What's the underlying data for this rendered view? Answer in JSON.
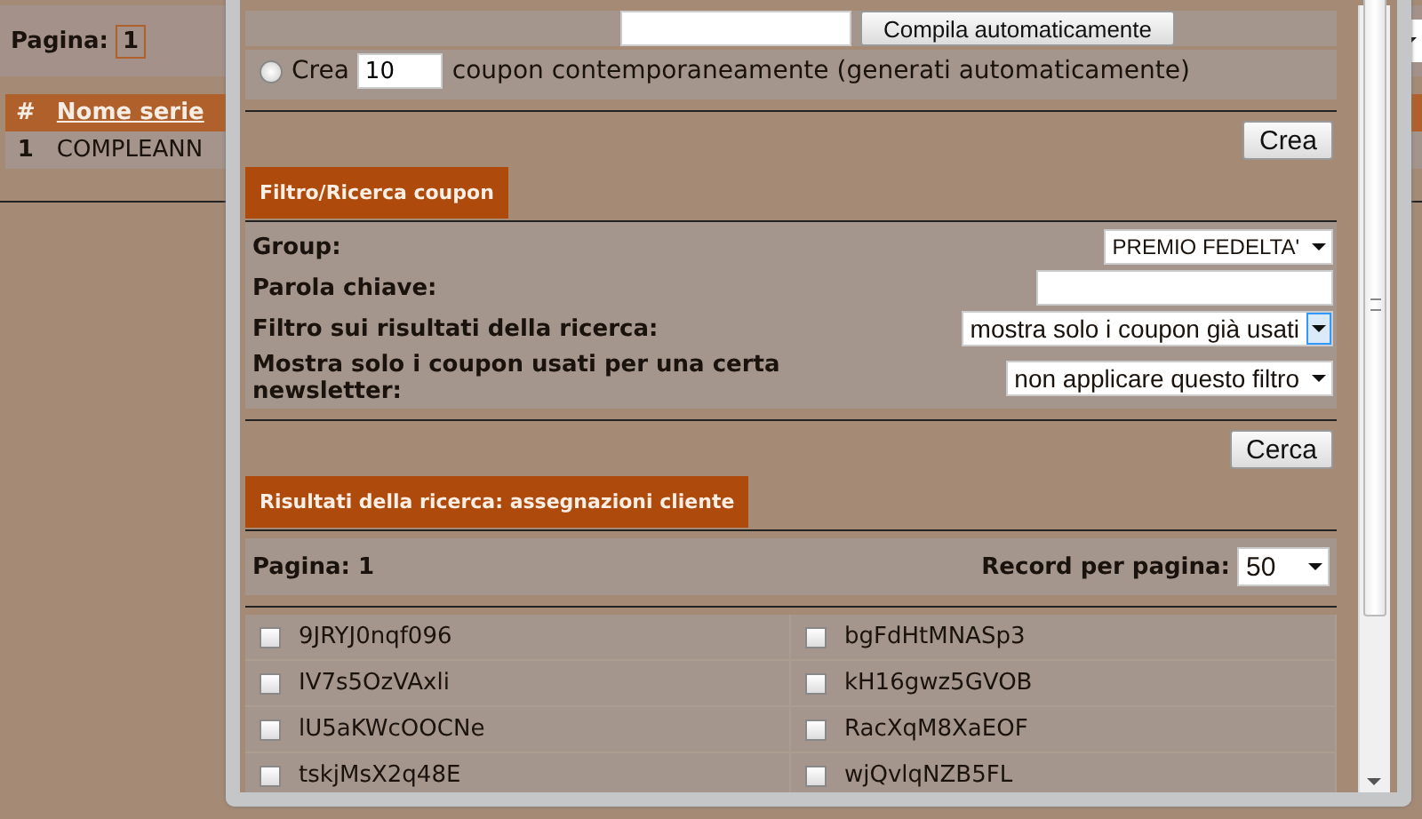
{
  "background_page": {
    "pagination": {
      "label": "Pagina:",
      "current": "1"
    },
    "table": {
      "columns": [
        "#",
        "Nome serie"
      ],
      "rows": [
        [
          "1",
          "COMPLEANN"
        ]
      ]
    }
  },
  "dialog": {
    "autofill": {
      "button": "Compila automaticamente"
    },
    "bulk_create": {
      "selected": false,
      "prefix": "Crea",
      "count": "10",
      "suffix": "coupon contemporaneamente (generati automaticamente)"
    },
    "create_button": "Crea",
    "filter_section": {
      "title": "Filtro/Ricerca coupon",
      "fields": [
        {
          "kind": "select",
          "label": "Group:",
          "value": "PREMIO FEDELTA'",
          "focused": false
        },
        {
          "kind": "input",
          "label": "Parola chiave:",
          "focused": false
        },
        {
          "kind": "select",
          "label": "Filtro sui risultati della ricerca:",
          "value": "mostra solo i coupon già usati",
          "focused": true
        },
        {
          "kind": "select",
          "label": "Mostra solo i coupon usati per una certa newsletter:",
          "value": "non applicare questo filtro",
          "focused": false
        }
      ],
      "button": "Cerca"
    },
    "results_section": {
      "title": "Risultati della ricerca: assegnazioni cliente",
      "page_label": "Pagina:",
      "page": "1",
      "per_page_label": "Record per pagina:",
      "per_page": "50",
      "coupons": [
        {
          "code": "9JRYJ0nqf096",
          "checked": false
        },
        {
          "code": "bgFdHtMNASp3",
          "checked": false
        },
        {
          "code": "IV7s5OzVAxli",
          "checked": false
        },
        {
          "code": "kH16gwz5GVOB",
          "checked": false
        },
        {
          "code": "lU5aKWcOOCNe",
          "checked": false
        },
        {
          "code": "RacXqM8XaEOF",
          "checked": false
        },
        {
          "code": "tskjMsX2q48E",
          "checked": false
        },
        {
          "code": "wjQvlqNZB5FL",
          "checked": false
        }
      ]
    }
  }
}
